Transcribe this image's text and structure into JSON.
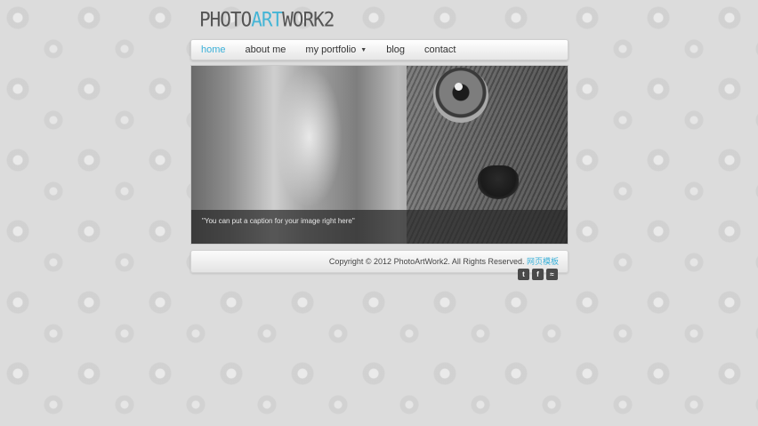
{
  "logo": {
    "part1": "PHOTO",
    "accent": "ART",
    "part2": "WORK",
    "suffix": "2"
  },
  "nav": {
    "home": "home",
    "about": "about me",
    "portfolio": "my portfolio",
    "blog": "blog",
    "contact": "contact"
  },
  "slider": {
    "caption": "\"You can put a caption for your image right here\""
  },
  "footer": {
    "copyright": "Copyright © 2012 PhotoArtWork2. All Rights Reserved.",
    "link": "网页模板"
  },
  "social": {
    "twitter": "t",
    "facebook": "f",
    "rss": "≈"
  },
  "colors": {
    "accent": "#3ab0d8",
    "nav_text": "#333333"
  }
}
